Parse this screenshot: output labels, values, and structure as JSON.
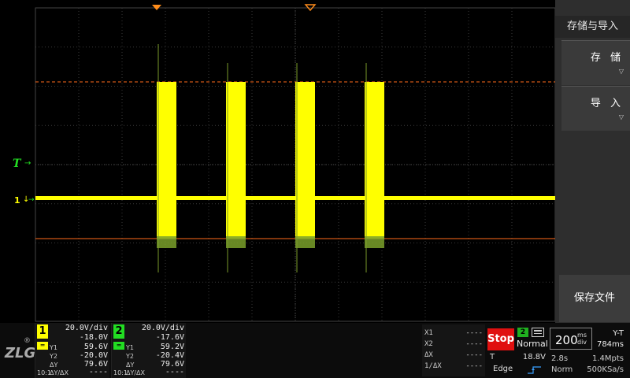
{
  "colors": {
    "ch1": "#ffff00",
    "ch2": "#22dd22",
    "cursor_line": "#ff6a1a",
    "grid": "#3a3a3a",
    "stop": "#e01010"
  },
  "markers": {
    "trigger_label": "T",
    "ch1_label": "1"
  },
  "menu": {
    "title": "存储与导入",
    "store_label": "存 储",
    "import_label": "导 入",
    "save_file_label": "保存文件"
  },
  "logo": {
    "text": "ZLG",
    "registered": "®"
  },
  "ch1": {
    "num": "1",
    "coupling_icon": "dc-coupling-icon",
    "scale": "20.0V/div",
    "offset": "-18.0V",
    "y1_label": "Y1",
    "y1": "59.6V",
    "y2_label": "Y2",
    "y2": "-20.0V",
    "dy_label": "ΔY",
    "dy": "79.6V",
    "probe": "10:1",
    "ratio_label": "ΔY/ΔX",
    "ratio": "----"
  },
  "ch2": {
    "num": "2",
    "coupling_icon": "dc-coupling-icon",
    "scale": "20.0V/div",
    "offset": "-17.6V",
    "y1_label": "Y1",
    "y1": "59.2V",
    "y2_label": "Y2",
    "y2": "-20.4V",
    "dy_label": "ΔY",
    "dy": "79.6V",
    "probe": "10:1",
    "ratio_label": "ΔY/ΔX",
    "ratio": "----"
  },
  "cursors": {
    "x1_label": "X1",
    "x1": "----",
    "x2_label": "X2",
    "x2": "----",
    "dx_label": "ΔX",
    "dx": "----",
    "inv_dx_label": "1/ΔX",
    "inv_dx": "----"
  },
  "trigger": {
    "run_state": "Stop",
    "source": "2",
    "mode": "Normal",
    "level_label": "T",
    "level": "18.8V",
    "type": "Edge",
    "slope_icon": "rising-edge-icon"
  },
  "timebase": {
    "scale": "200",
    "unit_top": "ms",
    "unit_bottom": "div",
    "display_mode": "Y-T",
    "delay": "784ms",
    "record_length": "2.8s",
    "memory_depth": "1.4Mpts",
    "acq_mode": "Norm",
    "sample_rate": "500KSa/s"
  },
  "waveform": {
    "burst_count": 4,
    "ch1_baseline_div": -0.35,
    "burst_high_div": 2.95,
    "burst_low_div": -0.95
  }
}
